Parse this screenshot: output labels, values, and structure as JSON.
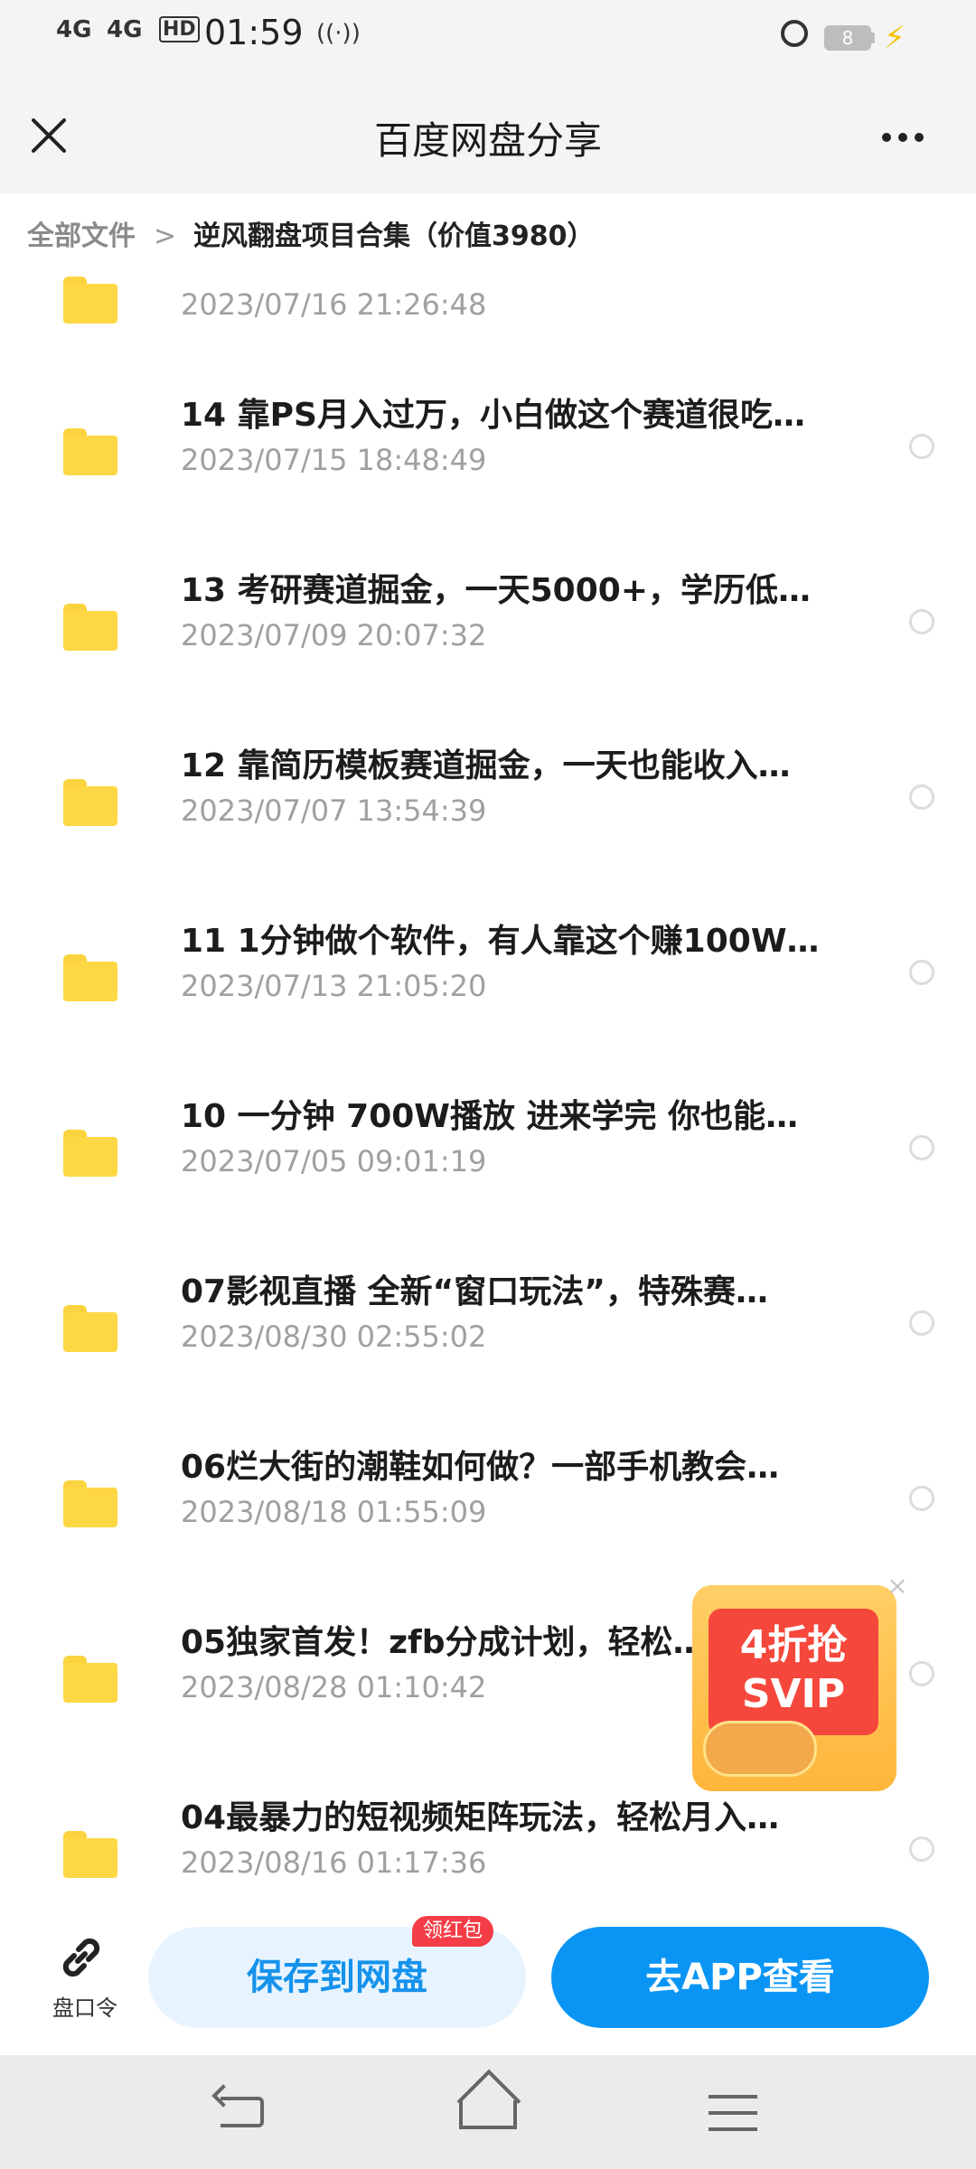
{
  "status_bar": {
    "signal_1": "4G",
    "signal_2": "4G",
    "hd": "HD",
    "time": "01:59",
    "battery": "8"
  },
  "header": {
    "title": "百度网盘分享"
  },
  "breadcrumb": {
    "root": "全部文件",
    "separator": ">",
    "current": "逆风翻盘项目合集（价值3980）"
  },
  "files": [
    {
      "title": "",
      "time": "2023/07/16 21:26:48"
    },
    {
      "title": "14 靠PS月入过万，小白做这个赛道很吃…",
      "time": "2023/07/15 18:48:49"
    },
    {
      "title": "13 考研赛道掘金，一天5000+，学历低…",
      "time": "2023/07/09 20:07:32"
    },
    {
      "title": "12 靠简历模板赛道掘金，一天也能收入…",
      "time": "2023/07/07 13:54:39"
    },
    {
      "title": "11 1分钟做个软件，有人靠这个赚100W…",
      "time": "2023/07/13 21:05:20"
    },
    {
      "title": "10 一分钟 700W播放 进来学完 你也能…",
      "time": "2023/07/05 09:01:19"
    },
    {
      "title": "07影视直播 全新“窗口玩法”，特殊赛…",
      "time": "2023/08/30 02:55:02"
    },
    {
      "title": "06烂大街的潮鞋如何做？一部手机教会…",
      "time": "2023/08/18 01:55:09"
    },
    {
      "title": "05独家首发！zfb分成计划，轻松…",
      "time": "2023/08/28 01:10:42"
    },
    {
      "title": "04最暴力的短视频矩阵玩法，轻松月入…",
      "time": "2023/08/16 01:17:36"
    }
  ],
  "promo": {
    "line1": "4折抢",
    "line2": "SVIP"
  },
  "bottom": {
    "link_label": "盘口令",
    "save_label": "保存到网盘",
    "badge": "领红包",
    "app_label": "去APP查看"
  }
}
